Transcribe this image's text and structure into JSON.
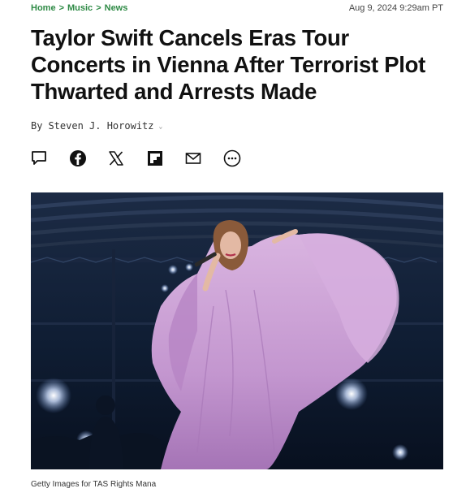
{
  "breadcrumb": {
    "items": [
      "Home",
      "Music",
      "News"
    ],
    "separator": ">"
  },
  "dateline": "Aug 9, 2024 9:29am PT",
  "article": {
    "title": "Taylor Swift Cancels Eras Tour Concerts in Vienna After Terrorist Plot Thwarted and Arrests Made",
    "byline_prefix": "By",
    "author": "Steven J. Horowitz",
    "caret": "⌄"
  },
  "share_icons": [
    "comment-icon",
    "facebook-icon",
    "x-icon",
    "flipboard-icon",
    "email-icon",
    "more-icon"
  ],
  "image": {
    "caption": "Getty Images for TAS Rights Mana"
  },
  "colors": {
    "breadcrumb": "#2e8a45",
    "dress": "#c79bd0",
    "stage_background": "#0d1a2e"
  }
}
